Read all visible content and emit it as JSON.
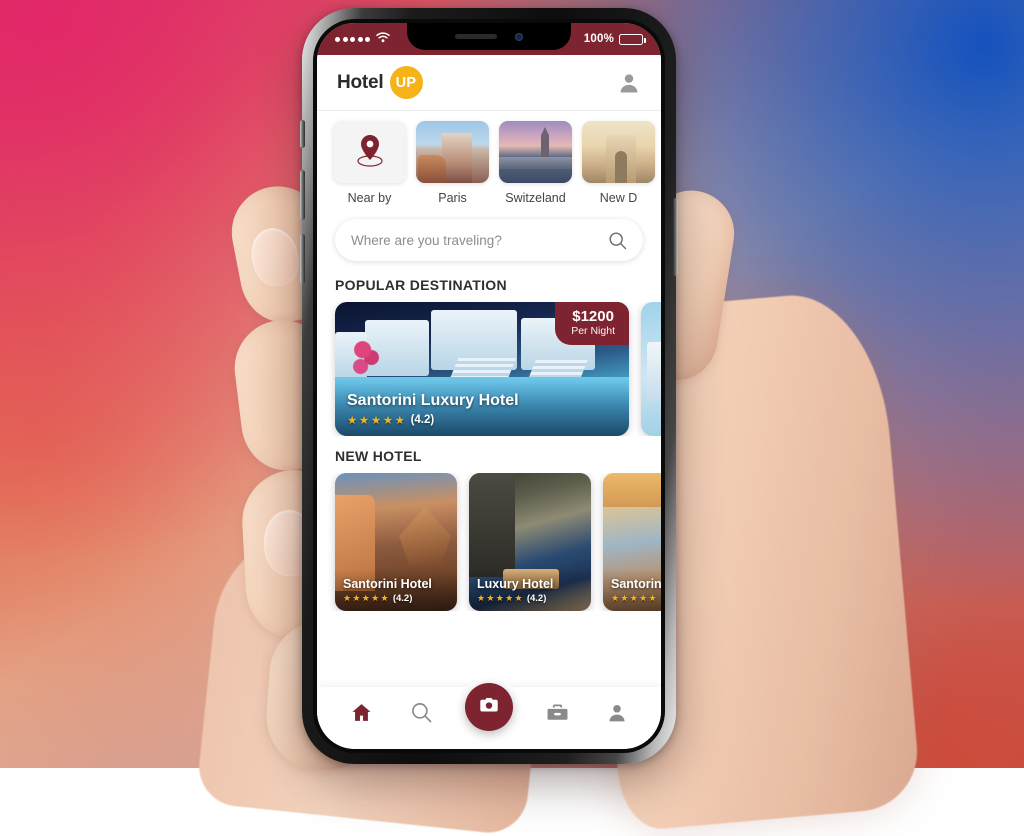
{
  "device": {
    "status_bar": {
      "signal_dots": 5,
      "wifi_icon": "wifi-icon",
      "battery_percent": "100%",
      "battery_icon": "battery-full-icon",
      "background_color": "#7e2430"
    },
    "notch": {
      "speaker": "speaker-grille",
      "camera": "front-camera-icon"
    }
  },
  "header": {
    "logo_text": "Hotel",
    "logo_badge": "UP",
    "badge_color": "#f5b319",
    "avatar_icon": "user-avatar-icon"
  },
  "categories": [
    {
      "label": "Near by",
      "icon": "location-pin-icon",
      "type": "icon"
    },
    {
      "label": "Paris",
      "icon": "paris-photo",
      "type": "photo"
    },
    {
      "label": "Switzeland",
      "icon": "switzerland-photo",
      "type": "photo"
    },
    {
      "label": "New D",
      "icon": "new-delhi-photo",
      "type": "photo"
    }
  ],
  "search": {
    "placeholder": "Where are you traveling?",
    "value": "",
    "icon": "search-icon"
  },
  "popular": {
    "section_title": "POPULAR DESTINATION",
    "cards": [
      {
        "title": "Santorini Luxury Hotel",
        "stars": "★★★★★",
        "rating": "(4.2)",
        "price_value": "$1200",
        "price_unit": "Per Night",
        "badge_color": "#7e2430"
      }
    ]
  },
  "new_hotel": {
    "section_title": "NEW HOTEL",
    "cards": [
      {
        "title": "Santorini Hotel",
        "stars": "★★★★★",
        "rating": "(4.2)"
      },
      {
        "title": "Luxury Hotel",
        "stars": "★★★★★",
        "rating": "(4.2)"
      },
      {
        "title": "Santorin",
        "stars": "★★★★★",
        "rating": ""
      }
    ]
  },
  "bottom_nav": {
    "items": [
      {
        "name": "home",
        "icon": "home-icon",
        "active": true
      },
      {
        "name": "search",
        "icon": "search-icon",
        "active": false
      },
      {
        "name": "camera",
        "icon": "camera-icon",
        "active": true
      },
      {
        "name": "briefcase",
        "icon": "briefcase-icon",
        "active": false
      },
      {
        "name": "profile",
        "icon": "person-icon",
        "active": false
      }
    ],
    "accent_color": "#7e2430"
  }
}
